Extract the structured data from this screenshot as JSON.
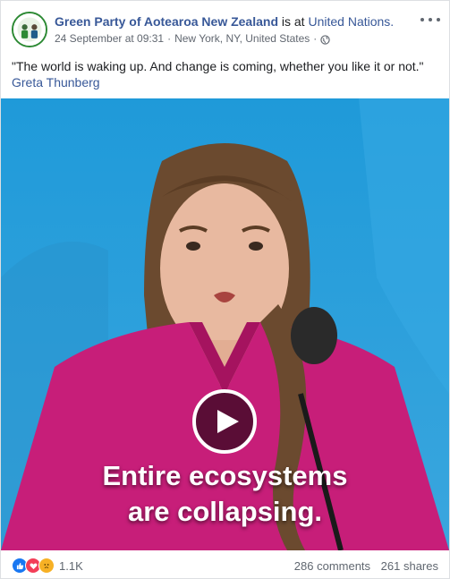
{
  "post": {
    "page_name": "Green Party of Aotearoa New Zealand",
    "is_at_text": "is at",
    "location_name": "United Nations.",
    "timestamp": "24 September at 09:31",
    "separator": "·",
    "place": "New York, NY, United States",
    "privacy_icon": "globe-icon",
    "more_icon": "more-options-icon",
    "message": "\"The world is waking up. And change is coming, whether you like it or not.\"",
    "message_author": "Greta Thunberg"
  },
  "video": {
    "caption_line1": "Entire ecosystems",
    "caption_line2": "are collapsing.",
    "play_icon": "play-icon",
    "background_color": "#2a9fd8",
    "shirt_color": "#c71e79"
  },
  "footer": {
    "reactions": [
      "like",
      "love",
      "sad"
    ],
    "reaction_count": "1.1K",
    "comments": "286 comments",
    "shares": "261 shares"
  },
  "colors": {
    "link": "#385898",
    "meta": "#616770",
    "like": "#1877f2",
    "love": "#f33e58",
    "sad": "#f7b125"
  }
}
